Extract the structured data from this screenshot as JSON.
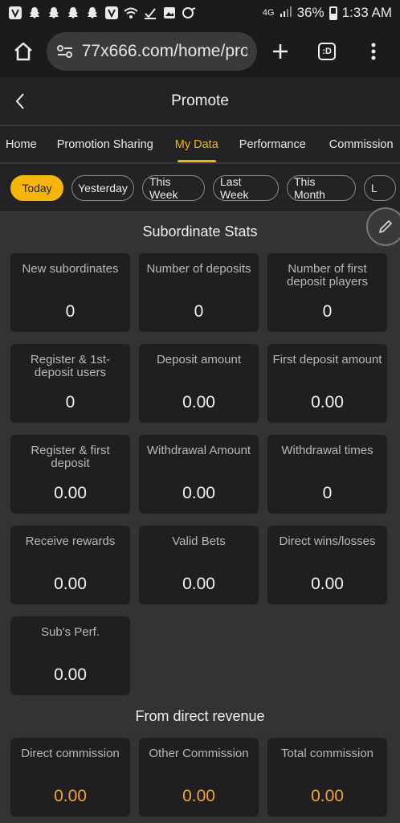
{
  "status_bar": {
    "battery": "36%",
    "time": "1:33 AM",
    "network": "4G"
  },
  "browser": {
    "url": "77x666.com/home/pro",
    "tab_count": ":D"
  },
  "header": {
    "title": "Promote"
  },
  "nav_tabs": [
    "Home",
    "Promotion Sharing",
    "My Data",
    "Performance",
    "Commission"
  ],
  "date_filters": [
    "Today",
    "Yesterday",
    "This Week",
    "Last Week",
    "This Month",
    "L"
  ],
  "subordinate_stats": {
    "title": "Subordinate Stats",
    "cards": [
      {
        "label": "New subordinates",
        "value": "0"
      },
      {
        "label": "Number of deposits",
        "value": "0"
      },
      {
        "label": "Number of first deposit players",
        "value": "0"
      },
      {
        "label": "Register & 1st-deposit users",
        "value": "0"
      },
      {
        "label": "Deposit amount",
        "value": "0.00"
      },
      {
        "label": "First deposit amount",
        "value": "0.00"
      },
      {
        "label": "Register & first deposit",
        "value": "0.00"
      },
      {
        "label": "Withdrawal Amount",
        "value": "0.00"
      },
      {
        "label": "Withdrawal times",
        "value": "0"
      },
      {
        "label": "Receive rewards",
        "value": "0.00"
      },
      {
        "label": "Valid Bets",
        "value": "0.00"
      },
      {
        "label": "Direct wins/losses",
        "value": "0.00"
      },
      {
        "label": "Sub's Perf.",
        "value": "0.00"
      }
    ]
  },
  "direct_revenue": {
    "title": "From direct revenue",
    "cards": [
      {
        "label": "Direct commission",
        "value": "0.00"
      },
      {
        "label": "Other Commission",
        "value": "0.00"
      },
      {
        "label": "Total commission",
        "value": "0.00"
      }
    ]
  },
  "colors": {
    "accent": "#f5b50a",
    "value_gold": "#f5a623",
    "card_bg": "#1f1f21",
    "page_bg": "#333335"
  }
}
